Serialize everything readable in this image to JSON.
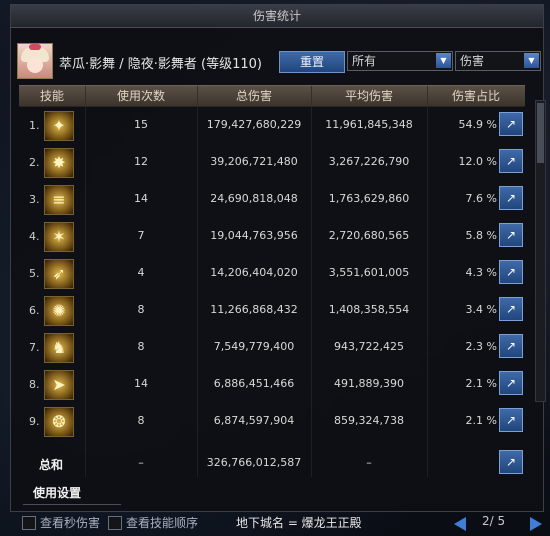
{
  "window": {
    "title": "伤害统计"
  },
  "header": {
    "character": "萃瓜·影舞 / 隐夜·影舞者 (等级110)",
    "reset_label": "重置",
    "filter1": "所有",
    "filter2": "伤害"
  },
  "table": {
    "columns": [
      "技能",
      "使用次数",
      "总伤害",
      "平均伤害",
      "伤害占比"
    ],
    "rows": [
      {
        "rank": "1.",
        "icon": "skill-1-icon",
        "uses": "15",
        "total": "179,427,680,229",
        "avg": "11,961,845,348",
        "pct": "54.9 %"
      },
      {
        "rank": "2.",
        "icon": "skill-2-icon",
        "uses": "12",
        "total": "39,206,721,480",
        "avg": "3,267,226,790",
        "pct": "12.0 %"
      },
      {
        "rank": "3.",
        "icon": "skill-3-icon",
        "uses": "14",
        "total": "24,690,818,048",
        "avg": "1,763,629,860",
        "pct": "7.6 %"
      },
      {
        "rank": "4.",
        "icon": "skill-4-icon",
        "uses": "7",
        "total": "19,044,763,956",
        "avg": "2,720,680,565",
        "pct": "5.8 %"
      },
      {
        "rank": "5.",
        "icon": "skill-5-icon",
        "uses": "4",
        "total": "14,206,404,020",
        "avg": "3,551,601,005",
        "pct": "4.3 %"
      },
      {
        "rank": "6.",
        "icon": "skill-6-icon",
        "uses": "8",
        "total": "11,266,868,432",
        "avg": "1,408,358,554",
        "pct": "3.4 %"
      },
      {
        "rank": "7.",
        "icon": "skill-7-icon",
        "uses": "8",
        "total": "7,549,779,400",
        "avg": "943,722,425",
        "pct": "2.3 %"
      },
      {
        "rank": "8.",
        "icon": "skill-8-icon",
        "uses": "14",
        "total": "6,886,451,466",
        "avg": "491,889,390",
        "pct": "2.1 %"
      },
      {
        "rank": "9.",
        "icon": "skill-9-icon",
        "uses": "8",
        "total": "6,874,597,904",
        "avg": "859,324,738",
        "pct": "2.1 %"
      }
    ],
    "total": {
      "label": "总和",
      "uses": "–",
      "total": "326,766,012,587",
      "avg": "–"
    }
  },
  "footer": {
    "settings_tab": "使用设置",
    "check1": "查看秒伤害",
    "check2": "查看技能顺序",
    "dungeon": "地下城名 = 爆龙王正殿",
    "page": "2/ 5"
  },
  "colors": {
    "accent_blue": "#2c5598",
    "header_brown": "#4a4138"
  }
}
